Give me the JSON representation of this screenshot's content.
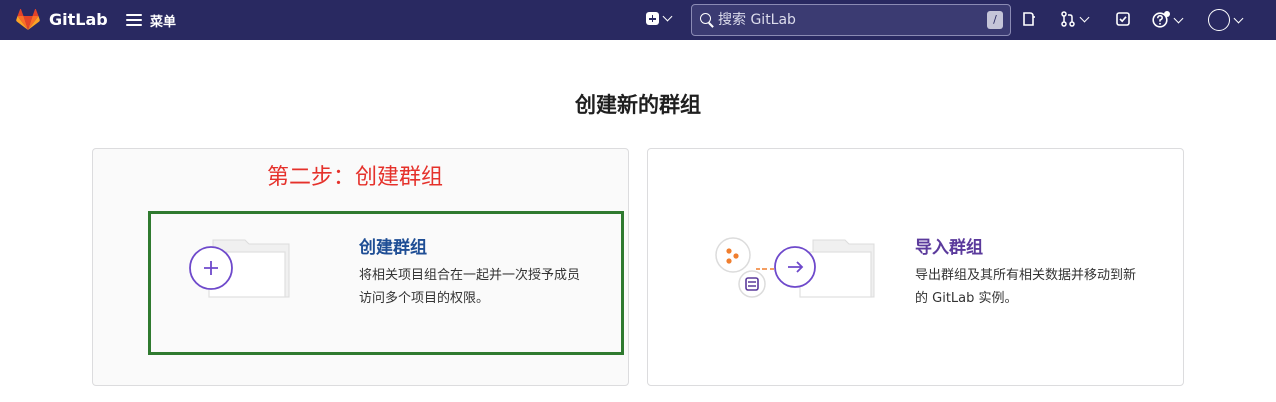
{
  "header": {
    "brand": "GitLab",
    "menu_label": "菜单",
    "search_placeholder": "搜索 GitLab",
    "search_shortcut": "/"
  },
  "page": {
    "title": "创建新的群组",
    "annotation": "第二步：创建群组"
  },
  "options": [
    {
      "title": "创建群组",
      "description": "将相关项目组合在一起并一次授予成员访问多个项目的权限。"
    },
    {
      "title": "导入群组",
      "description": "导出群组及其所有相关数据并移动到新的 GitLab 实例。"
    }
  ],
  "colors": {
    "topbar": "#292961",
    "create_title": "#1f4e95",
    "import_title": "#5b3a9c",
    "annotation": "#e5312b",
    "highlight_border": "#2f7a2f",
    "accent_purple": "#6e49cb"
  }
}
